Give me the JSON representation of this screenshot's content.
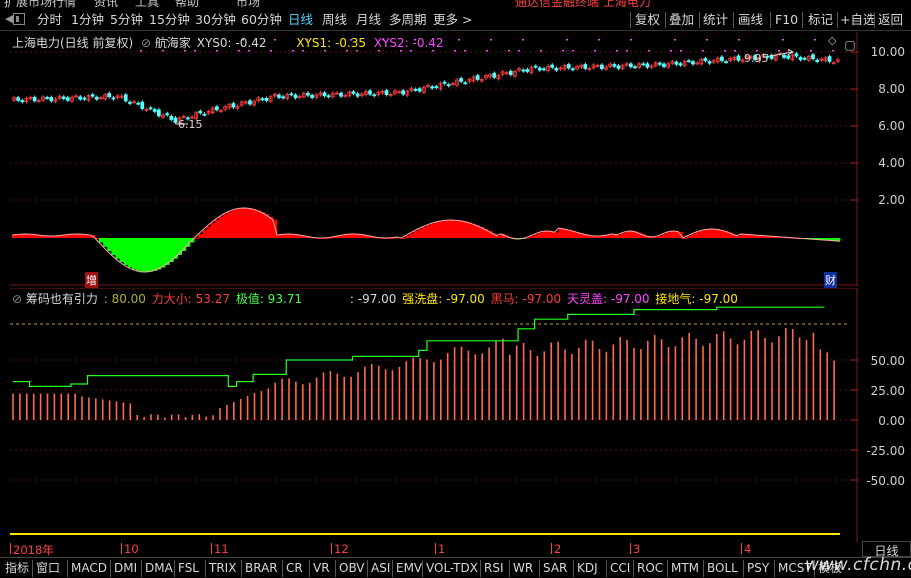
{
  "menu": {
    "items": [
      "扩展市场行情",
      "资讯",
      "工具",
      "帮助",
      "市场"
    ],
    "banner": "通达信金融终端 上海电力"
  },
  "toolbar": {
    "periods": [
      "分时",
      "1分钟",
      "5分钟",
      "15分钟",
      "30分钟",
      "60分钟",
      "日线",
      "周线",
      "月线",
      "多周期",
      "更多 >"
    ],
    "active": "日线",
    "right": [
      "复权",
      "叠加",
      "统计",
      "画线",
      "F10",
      "标记",
      "+自选",
      "返回"
    ]
  },
  "price_pane": {
    "stock": "上海电力(日线 前复权)",
    "indicator_name": "航海家",
    "xys0": "XYS0: -0.42",
    "xys1": "XYS1: -0.35",
    "xys2": "XYS2: -0.42",
    "low_label": "6.15",
    "high_label": "9.95",
    "marker_zeng": "增",
    "marker_cai": "财",
    "y_axis": [
      "10.00",
      "8.00",
      "6.00",
      "4.00",
      "2.00"
    ]
  },
  "ind_pane": {
    "name": "筹码也有引力",
    "v1": ": 80.00",
    "v2": "力大小: 53.27",
    "v3": "极值: 93.71",
    "v4": ": -97.00",
    "v5": "强洗盘: -97.00",
    "v6": "黑马: -97.00",
    "v7": "天灵盖: -97.00",
    "v8": "接地气: -97.00",
    "y_axis": [
      "50.00",
      "25.00",
      "0.00",
      "-25.00",
      "-50.00"
    ]
  },
  "time_axis": [
    "2018年",
    "10",
    "11",
    "12",
    "1",
    "2",
    "3",
    "4"
  ],
  "bottom_tabs": [
    "指标",
    "窗口",
    "MACD",
    "DMI",
    "DMA",
    "FSL",
    "TRIX",
    "BRAR",
    "CR",
    "VR",
    "OBV",
    "ASI",
    "EMV",
    "VOL-TDX",
    "RSI",
    "WR",
    "SAR",
    "KDJ",
    "CCI",
    "ROC",
    "MTM",
    "BOLL",
    "PSY",
    "MCST",
    "模板"
  ],
  "right_period": "日线",
  "watermark": "www.cfchn.com",
  "colors": {
    "up": "#ff3c3c",
    "down": "#54ffff",
    "green": "#00ff00",
    "yellow": "#ffe600",
    "magenta": "#ff44ff",
    "axis_red": "#7a1a1a"
  }
}
